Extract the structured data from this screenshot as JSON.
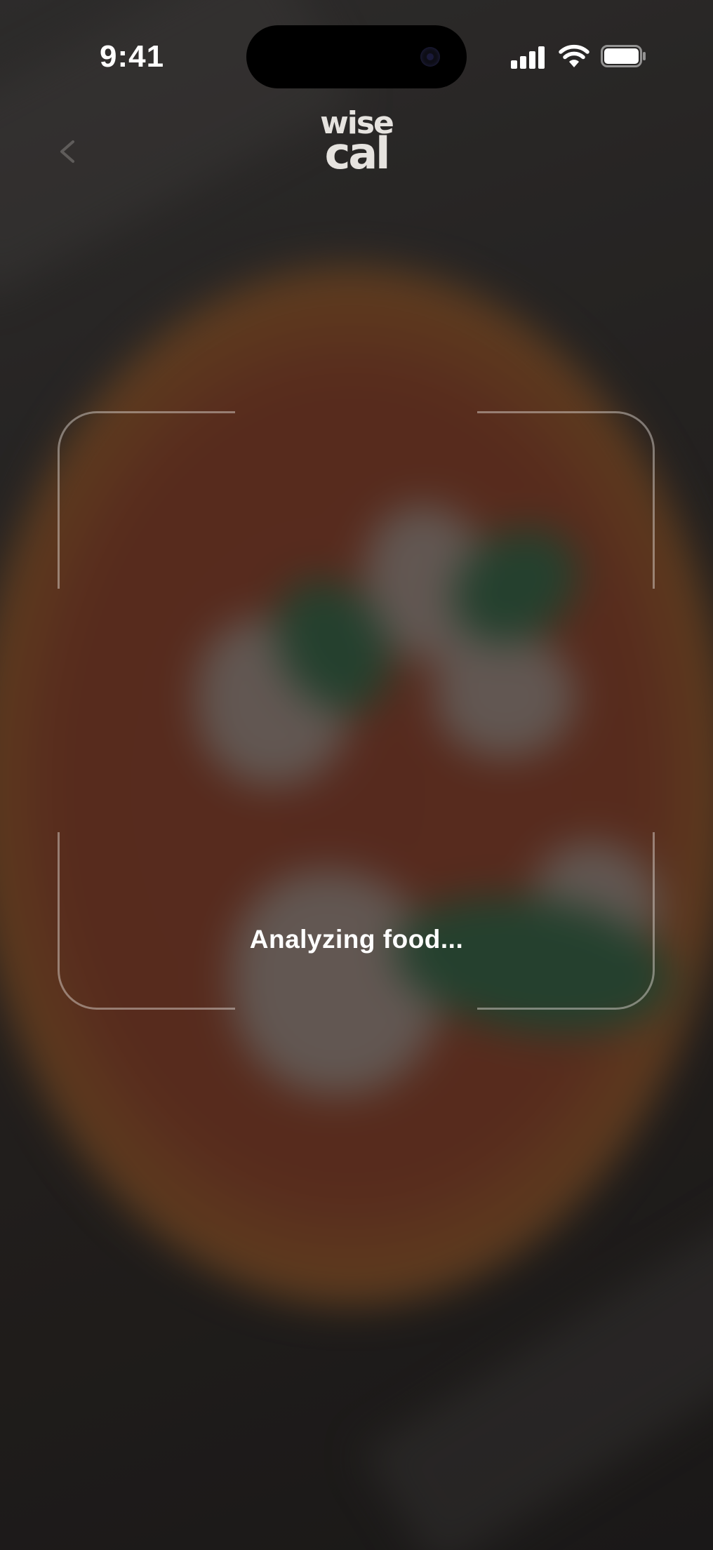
{
  "status_bar": {
    "time": "9:41",
    "icons": [
      "cellular-signal-icon",
      "wifi-icon",
      "battery-icon"
    ]
  },
  "header": {
    "back_icon": "chevron-left-icon",
    "logo_line1": "wise",
    "logo_line2": "cal"
  },
  "scanner": {
    "status_text": "Analyzing food..."
  },
  "colors": {
    "text": "#ffffff",
    "frame": "#e6e1dc",
    "logo": "#e6e3df"
  }
}
